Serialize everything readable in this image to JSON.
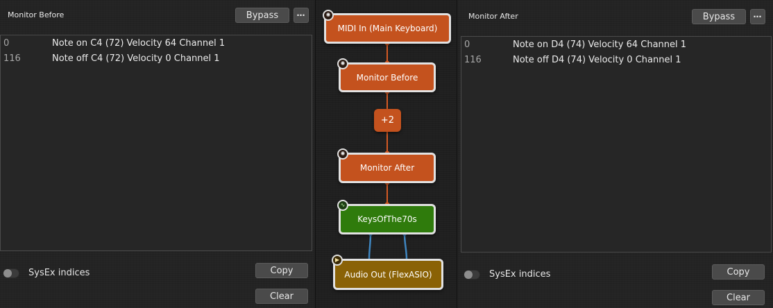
{
  "left_monitor": {
    "title": "Monitor Before",
    "bypass_label": "Bypass",
    "more_label": "⋯",
    "log": [
      {
        "time": "0",
        "message": "Note on C4 (72) Velocity 64 Channel 1"
      },
      {
        "time": "116",
        "message": "Note off C4 (72) Velocity 0 Channel 1"
      }
    ],
    "sysex_label": "SysEx indices",
    "sysex_enabled": false,
    "copy_label": "Copy",
    "clear_label": "Clear"
  },
  "right_monitor": {
    "title": "Monitor After",
    "bypass_label": "Bypass",
    "more_label": "⋯",
    "log": [
      {
        "time": "0",
        "message": "Note on D4 (74) Velocity 64 Channel 1"
      },
      {
        "time": "116",
        "message": "Note off D4 (74) Velocity 0 Channel 1"
      }
    ],
    "sysex_label": "SysEx indices",
    "sysex_enabled": false,
    "copy_label": "Copy",
    "clear_label": "Clear"
  },
  "graph": {
    "nodes": {
      "midi_in": "MIDI In (Main Keyboard)",
      "monitor_before": "Monitor Before",
      "transpose": "+2",
      "monitor_after": "Monitor After",
      "synth": "KeysOfThe70s",
      "audio_out": "Audio Out (FlexASIO)"
    },
    "icons": {
      "midi": "midi-din-icon",
      "synth": "waveform-icon",
      "audio": "speaker-icon"
    }
  },
  "colors": {
    "midi_node": "#c4521e",
    "synth_node": "#2f7b0c",
    "audio_node": "#8a6206",
    "midi_wire": "#d55a24",
    "audio_wire": "#3f86c0",
    "node_border": "#e2e2e2",
    "background": "#232323"
  }
}
